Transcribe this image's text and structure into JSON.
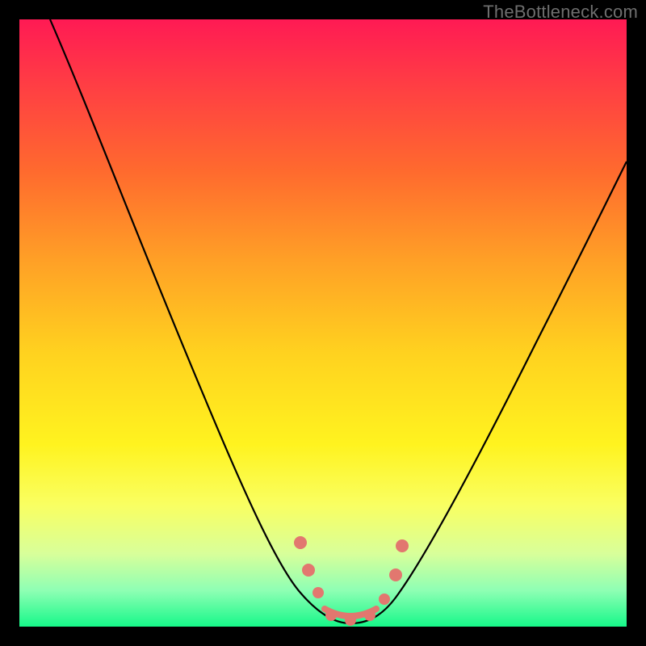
{
  "watermark": "TheBottleneck.com",
  "colors": {
    "gradient_top": "#ff1a54",
    "gradient_mid1": "#ffa126",
    "gradient_mid2": "#fff31f",
    "gradient_bottom": "#16f889",
    "curve": "#000000",
    "markers": "#e2776f",
    "frame": "#000000"
  },
  "chart_data": {
    "type": "line",
    "title": "",
    "xlabel": "",
    "ylabel": "",
    "xlim": [
      0,
      100
    ],
    "ylim": [
      0,
      100
    ],
    "grid": false,
    "legend": false,
    "series": [
      {
        "name": "bottleneck-curve",
        "x": [
          5,
          10,
          15,
          20,
          25,
          30,
          35,
          40,
          45,
          47,
          50,
          52,
          55,
          57,
          60,
          65,
          70,
          75,
          80,
          85,
          90,
          95,
          100
        ],
        "y": [
          100,
          92,
          84,
          76,
          67,
          57,
          47,
          36,
          22,
          14,
          4,
          2,
          2,
          2,
          5,
          12,
          20,
          28,
          36,
          44,
          52,
          59,
          66
        ]
      }
    ],
    "markers": {
      "name": "highlight-points",
      "points": [
        {
          "x": 46,
          "y": 14
        },
        {
          "x": 48,
          "y": 8
        },
        {
          "x": 50,
          "y": 4
        },
        {
          "x": 52,
          "y": 2
        },
        {
          "x": 55,
          "y": 2
        },
        {
          "x": 57,
          "y": 2
        },
        {
          "x": 60,
          "y": 5
        },
        {
          "x": 62,
          "y": 10
        },
        {
          "x": 63,
          "y": 14
        }
      ]
    }
  }
}
